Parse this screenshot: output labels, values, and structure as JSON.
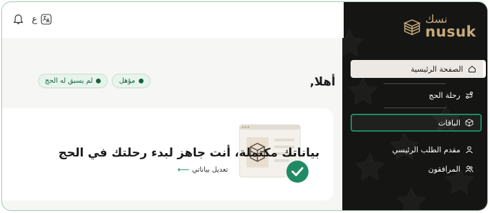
{
  "sidebar": {
    "logo": {
      "arabic": "نسك",
      "latin": "nusuk"
    },
    "items": [
      {
        "label": "الصفحة الرئيسية",
        "icon": "home-icon"
      },
      {
        "label": "رحلة الحج",
        "icon": "journey-icon"
      },
      {
        "label": "الباقات",
        "icon": "package-icon"
      },
      {
        "label": "مقدم الطلب الرئيسي",
        "icon": "user-icon"
      },
      {
        "label": "المرافقون",
        "icon": "users-icon"
      }
    ]
  },
  "topbar": {
    "language_label": "ع",
    "icons": [
      "bell-icon",
      "translate-icon"
    ]
  },
  "main": {
    "greeting": "أهلا,",
    "badges": [
      {
        "label": "مؤهل"
      },
      {
        "label": "لم يسبق له الحج"
      }
    ],
    "card": {
      "title": "بياناتك مكتملة، أنت جاهز لبدء رحلتك في الحج",
      "link_label": "تعديل بياناتي"
    }
  },
  "colors": {
    "sidebar_bg": "#151514",
    "gold": "#c9ab7a",
    "accent_green": "#1f8a64",
    "badge_bg": "#e7f4ec",
    "badge_text": "#14633f"
  }
}
